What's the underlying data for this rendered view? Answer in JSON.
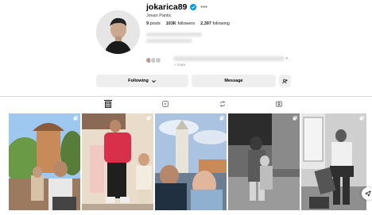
{
  "profile": {
    "username": "jokarica89",
    "full_name": "Jovan Pantic",
    "verified": true,
    "more_icon": "more-horizontal-icon",
    "stats": {
      "posts_count": "9",
      "posts_label": "posts",
      "followers_count": "103K",
      "followers_label": "followers",
      "following_count": "2,397",
      "following_label": "following"
    },
    "mutual_more_text": "+ more",
    "mutual_separator": "•"
  },
  "actions": {
    "following_label": "Following",
    "following_icon": "chevron-down-icon",
    "message_label": "Message",
    "suggest_icon": "add-person-icon"
  },
  "tabs": [
    {
      "icon": "grid-icon",
      "active": true
    },
    {
      "icon": "reels-icon",
      "active": false
    },
    {
      "icon": "repost-icon",
      "active": false
    },
    {
      "icon": "tagged-icon",
      "active": false
    }
  ],
  "posts": [
    {
      "type_icon": "carousel-icon"
    },
    {
      "type_icon": "carousel-icon"
    },
    {
      "type_icon": "carousel-icon"
    },
    {
      "type_icon": "carousel-icon"
    },
    {
      "type_icon": "carousel-icon"
    }
  ],
  "colors": {
    "verified": "#0095f6",
    "button_bg": "#efefef",
    "divider": "#dbdbdb"
  },
  "floating_action_icon": "send-icon"
}
